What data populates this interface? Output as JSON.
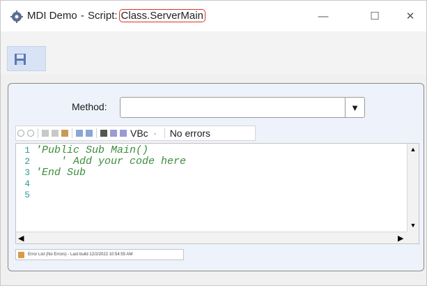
{
  "window": {
    "title_prefix": "MDI Demo",
    "title_sep": "-",
    "title_script": "Script:",
    "title_highlight": "Class.ServerMain",
    "app_icon": "gear-icon",
    "controls": {
      "minimize": "—",
      "maximize": "☐",
      "close": "✕"
    }
  },
  "toolbar": {
    "save_icon": "floppy-disk-icon"
  },
  "method": {
    "label": "Method:",
    "value": ""
  },
  "editor_toolbar": {
    "language": "VBc",
    "dot": "·",
    "status": "No errors"
  },
  "editor": {
    "line_numbers": [
      "1",
      "2",
      "3",
      "4",
      "5"
    ],
    "code": "'Public Sub Main()\n    ' Add your code here\n'End Sub"
  },
  "status": {
    "text": "Error List (No Errors) - Last build 12/2/2022 10:54:55 AM"
  },
  "colors": {
    "highlight_border": "#e0302b",
    "code_comment": "#3c8d3c",
    "line_numbers": "#2f9a9a",
    "selection": "#d8e4f6"
  }
}
